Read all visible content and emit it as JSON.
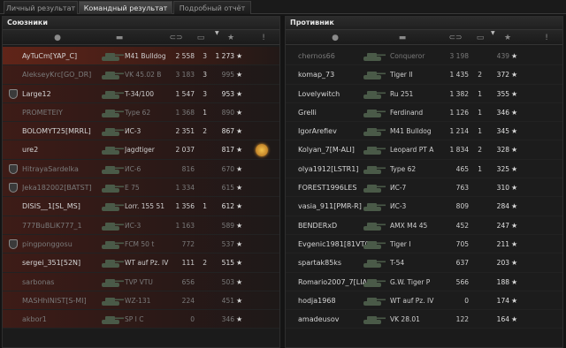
{
  "tabs": [
    {
      "label": "Личный результат",
      "active": false
    },
    {
      "label": "Командный результат",
      "active": true
    },
    {
      "label": "Подробный отчёт",
      "active": false
    }
  ],
  "allies": {
    "title": "Союзники",
    "rows": [
      {
        "name": "AyTuCm[YAP_C]",
        "tank": "M41 Bulldog",
        "damage": "2 558",
        "kills": "3",
        "score": "1 273",
        "style": "hl",
        "dead": false,
        "badge": false,
        "medal": false
      },
      {
        "name": "AlekseyKrc[GO_DR]",
        "tank": "VK 45.02 B",
        "damage": "3 183",
        "kills": "3",
        "score": "995",
        "style": "red",
        "dead": true,
        "badge": false,
        "medal": false
      },
      {
        "name": "Large12",
        "tank": "T-34/100",
        "damage": "1 547",
        "kills": "3",
        "score": "953",
        "style": "red",
        "dead": false,
        "badge": true,
        "medal": false
      },
      {
        "name": "PROMETEIY",
        "tank": "Type 62",
        "damage": "1 368",
        "kills": "1",
        "score": "890",
        "style": "red",
        "dead": true,
        "badge": false,
        "medal": false
      },
      {
        "name": "BOLOMYT25[MRRL]",
        "tank": "ИС-3",
        "damage": "2 351",
        "kills": "2",
        "score": "867",
        "style": "red",
        "dead": false,
        "badge": false,
        "medal": false
      },
      {
        "name": "ure2",
        "tank": "Jagdtiger",
        "damage": "2 037",
        "kills": "",
        "score": "817",
        "style": "red",
        "dead": false,
        "badge": false,
        "medal": true
      },
      {
        "name": "HitrayaSardelka",
        "tank": "ИС-6",
        "damage": "816",
        "kills": "",
        "score": "670",
        "style": "red",
        "dead": true,
        "badge": true,
        "medal": false
      },
      {
        "name": "Jeka182002[BATST]",
        "tank": "E 75",
        "damage": "1 334",
        "kills": "",
        "score": "615",
        "style": "red",
        "dead": true,
        "badge": true,
        "medal": false
      },
      {
        "name": "DISIS__1[SL_MS]",
        "tank": "Lorr. 155 51",
        "damage": "1 356",
        "kills": "1",
        "score": "612",
        "style": "red",
        "dead": false,
        "badge": false,
        "medal": false
      },
      {
        "name": "777BuBLiK777_1",
        "tank": "ИС-3",
        "damage": "1 163",
        "kills": "",
        "score": "589",
        "style": "red",
        "dead": true,
        "badge": false,
        "medal": false
      },
      {
        "name": "pingponggosu",
        "tank": "FCM 50 t",
        "damage": "772",
        "kills": "",
        "score": "537",
        "style": "red",
        "dead": true,
        "badge": true,
        "medal": false
      },
      {
        "name": "sergei_351[52N]",
        "tank": "WT auf Pz. IV",
        "damage": "111",
        "kills": "2",
        "score": "515",
        "style": "red",
        "dead": false,
        "badge": false,
        "medal": false
      },
      {
        "name": "sarbonas",
        "tank": "TVP VTU",
        "damage": "656",
        "kills": "",
        "score": "503",
        "style": "red",
        "dead": true,
        "badge": false,
        "medal": false
      },
      {
        "name": "MASHhINIST[S-MI]",
        "tank": "WZ-131",
        "damage": "224",
        "kills": "",
        "score": "451",
        "style": "red",
        "dead": true,
        "badge": false,
        "medal": false
      },
      {
        "name": "akbor1",
        "tank": "SP I C",
        "damage": "0",
        "kills": "",
        "score": "346",
        "style": "red",
        "dead": true,
        "badge": false,
        "medal": false
      }
    ]
  },
  "enemies": {
    "title": "Противник",
    "rows": [
      {
        "name": "chernos66",
        "tank": "Conqueror",
        "damage": "3 198",
        "kills": "",
        "score": "439",
        "style": "dim",
        "dead": true
      },
      {
        "name": "komap_73",
        "tank": "Tiger II",
        "damage": "1 435",
        "kills": "2",
        "score": "372",
        "style": "dim",
        "dead": false
      },
      {
        "name": "Lovelywitch",
        "tank": "Ru 251",
        "damage": "1 382",
        "kills": "1",
        "score": "355",
        "style": "dim",
        "dead": false
      },
      {
        "name": "Grelli",
        "tank": "Ferdinand",
        "damage": "1 126",
        "kills": "1",
        "score": "346",
        "style": "dim",
        "dead": false
      },
      {
        "name": "IgorArefiev",
        "tank": "M41 Bulldog",
        "damage": "1 214",
        "kills": "1",
        "score": "345",
        "style": "dim",
        "dead": false
      },
      {
        "name": "Kolyan_7[M-ALI]",
        "tank": "Leopard PT A",
        "damage": "1 834",
        "kills": "2",
        "score": "328",
        "style": "dim",
        "dead": false
      },
      {
        "name": "olya1912[LSTR1]",
        "tank": "Type 62",
        "damage": "465",
        "kills": "1",
        "score": "325",
        "style": "dim",
        "dead": false
      },
      {
        "name": "FOREST1996LES",
        "tank": "ИС-7",
        "damage": "763",
        "kills": "",
        "score": "310",
        "style": "dim",
        "dead": false
      },
      {
        "name": "vasia_911[PMR-R]",
        "tank": "ИС-3",
        "damage": "809",
        "kills": "",
        "score": "284",
        "style": "dim",
        "dead": false
      },
      {
        "name": "BENDERxD",
        "tank": "AMX M4 45",
        "damage": "452",
        "kills": "",
        "score": "247",
        "style": "dim",
        "dead": false
      },
      {
        "name": "Evgenic1981[81VTO]",
        "tank": "Tiger I",
        "damage": "705",
        "kills": "",
        "score": "211",
        "style": "dim",
        "dead": false
      },
      {
        "name": "spartak85ks",
        "tank": "T-54",
        "damage": "637",
        "kills": "",
        "score": "203",
        "style": "dim",
        "dead": false
      },
      {
        "name": "Romario2007_7[LIAM]",
        "tank": "G.W. Tiger P",
        "damage": "566",
        "kills": "",
        "score": "188",
        "style": "dim",
        "dead": false
      },
      {
        "name": "hodja1968",
        "tank": "WT auf Pz. IV",
        "damage": "0",
        "kills": "",
        "score": "174",
        "style": "dim",
        "dead": false
      },
      {
        "name": "amadeusov",
        "tank": "VK 28.01",
        "damage": "122",
        "kills": "",
        "score": "164",
        "style": "dim",
        "dead": false
      }
    ]
  },
  "icons": {
    "player": "person-icon",
    "tank": "tank-icon",
    "damage": "shell-icon",
    "kills": "kill-icon",
    "score": "star-icon",
    "achievements": "exclamation-icon"
  }
}
